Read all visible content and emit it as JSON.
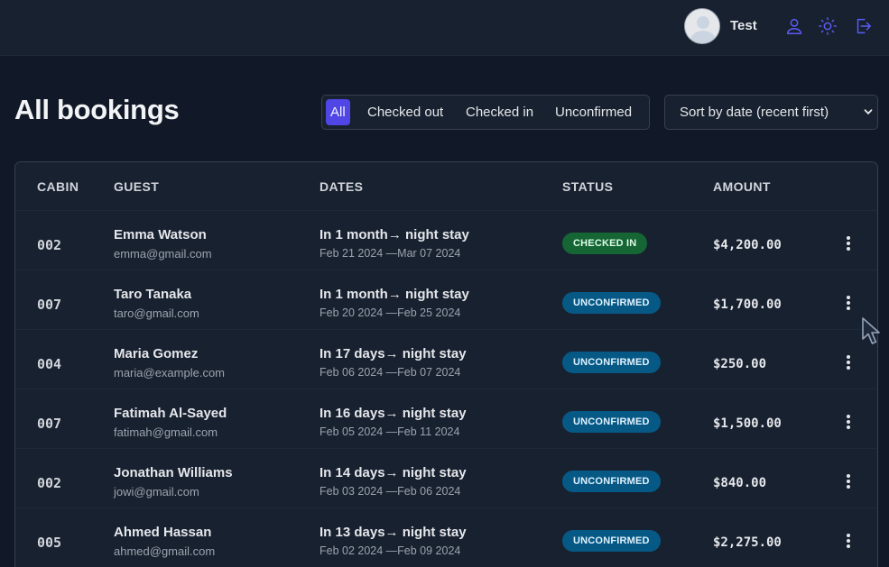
{
  "header": {
    "username": "Test",
    "icons": [
      "user-icon",
      "sun-icon",
      "logout-icon"
    ]
  },
  "page": {
    "title": "All bookings"
  },
  "filters": {
    "options": [
      "All",
      "Checked out",
      "Checked in",
      "Unconfirmed"
    ],
    "active": "All"
  },
  "sort": {
    "selected": "Sort by date (recent first)"
  },
  "table": {
    "headers": [
      "CABIN",
      "GUEST",
      "DATES",
      "STATUS",
      "AMOUNT"
    ],
    "rows": [
      {
        "cabin": "002",
        "guest": "Emma Watson",
        "email": "emma@gmail.com",
        "when": "In 1 month→ night stay",
        "range": "Feb 21 2024 —Mar 07 2024",
        "status": "CHECKED IN",
        "amount": "$4,200.00"
      },
      {
        "cabin": "007",
        "guest": "Taro Tanaka",
        "email": "taro@gmail.com",
        "when": "In 1 month→ night stay",
        "range": "Feb 20 2024 —Feb 25 2024",
        "status": "UNCONFIRMED",
        "amount": "$1,700.00"
      },
      {
        "cabin": "004",
        "guest": "Maria Gomez",
        "email": "maria@example.com",
        "when": "In 17 days→ night stay",
        "range": "Feb 06 2024 —Feb 07 2024",
        "status": "UNCONFIRMED",
        "amount": "$250.00"
      },
      {
        "cabin": "007",
        "guest": "Fatimah Al-Sayed",
        "email": "fatimah@gmail.com",
        "when": "In 16 days→ night stay",
        "range": "Feb 05 2024 —Feb 11 2024",
        "status": "UNCONFIRMED",
        "amount": "$1,500.00"
      },
      {
        "cabin": "002",
        "guest": "Jonathan Williams",
        "email": "jowi@gmail.com",
        "when": "In 14 days→ night stay",
        "range": "Feb 03 2024 —Feb 06 2024",
        "status": "UNCONFIRMED",
        "amount": "$840.00"
      },
      {
        "cabin": "005",
        "guest": "Ahmed Hassan",
        "email": "ahmed@gmail.com",
        "when": "In 13 days→ night stay",
        "range": "Feb 02 2024 —Feb 09 2024",
        "status": "UNCONFIRMED",
        "amount": "$2,275.00"
      }
    ]
  },
  "colors": {
    "accent": "#4f46e5",
    "checked_in_bg": "#166534",
    "checked_in_fg": "#dcfce7",
    "unconfirmed_bg": "#075985",
    "unconfirmed_fg": "#e0f2fe"
  }
}
